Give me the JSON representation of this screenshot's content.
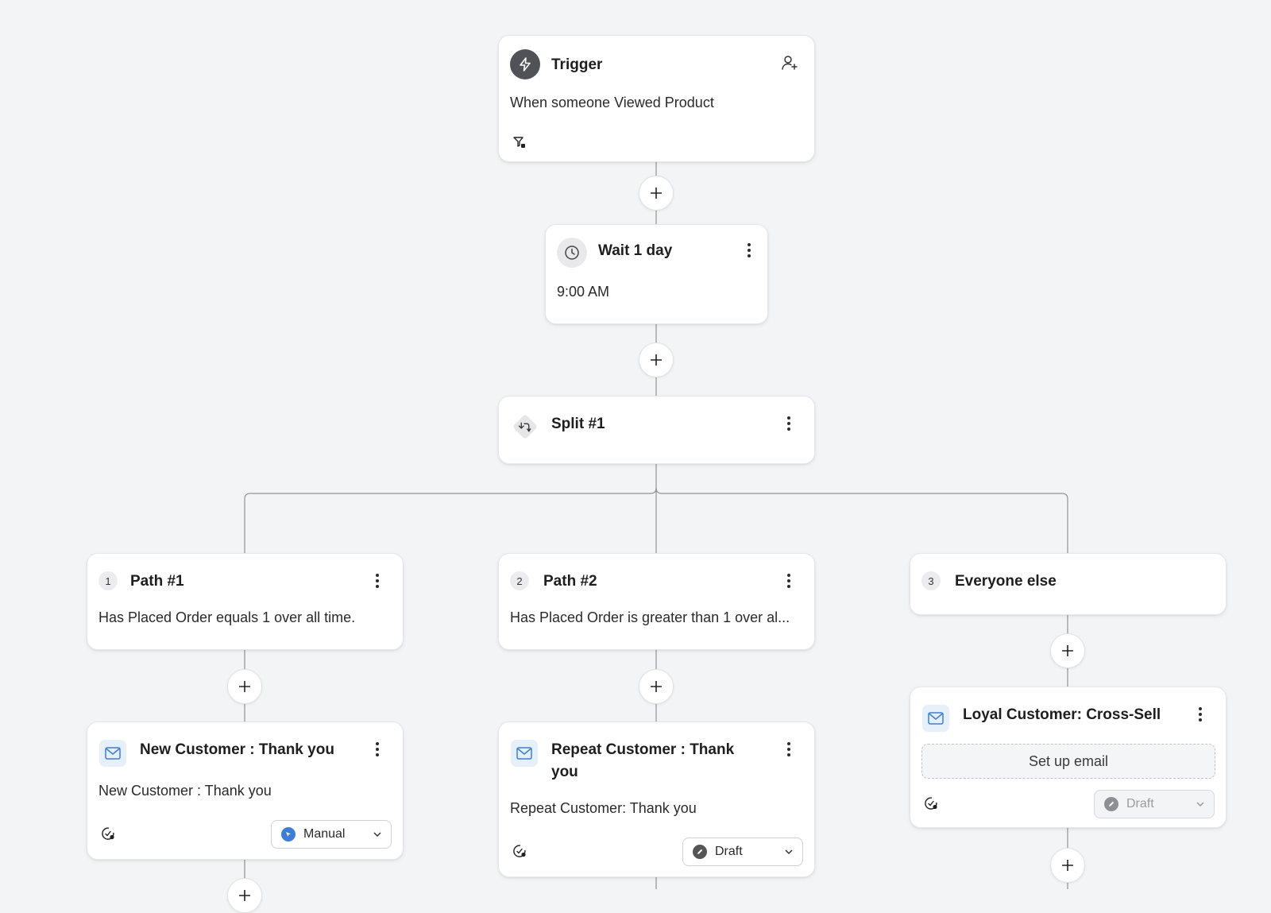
{
  "trigger": {
    "title": "Trigger",
    "description": "When someone Viewed Product"
  },
  "wait": {
    "title": "Wait 1 day",
    "time": "9:00 AM"
  },
  "split": {
    "title": "Split #1"
  },
  "paths": [
    {
      "number": "1",
      "title": "Path #1",
      "condition": "Has Placed Order equals 1 over all time."
    },
    {
      "number": "2",
      "title": "Path #2",
      "condition": "Has Placed Order is greater than 1 over al..."
    },
    {
      "number": "3",
      "title": "Everyone else"
    }
  ],
  "emails": [
    {
      "title": "New Customer : Thank you",
      "subject": "New Customer : Thank you",
      "status": "Manual"
    },
    {
      "title_line1": "Repeat Customer : Thank",
      "title_line2": "you",
      "subject": "Repeat Customer: Thank you",
      "status": "Draft"
    },
    {
      "title": "Loyal Customer: Cross-Sell",
      "setup_label": "Set up email",
      "status": "Draft"
    }
  ],
  "colors": {
    "background": "#f3f4f6",
    "manual_status": "#3b7ddd",
    "draft_status": "#555555",
    "mail_icon": "#3b7ddd"
  }
}
